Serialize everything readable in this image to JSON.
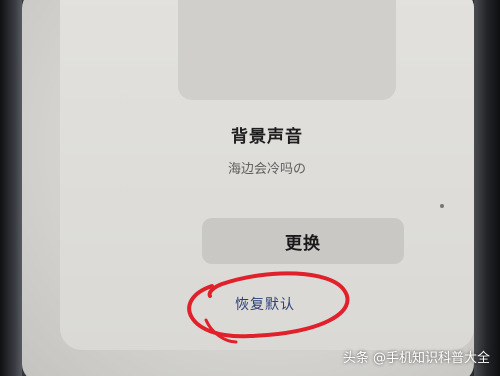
{
  "dialog": {
    "title": "背景声音",
    "subtitle": "海边会冷吗の",
    "change_button": "更换",
    "reset_link": "恢复默认"
  },
  "annotation": {
    "circle_color": "#e0202a"
  },
  "watermark": {
    "text": "头条 @手机知识科普大全"
  }
}
